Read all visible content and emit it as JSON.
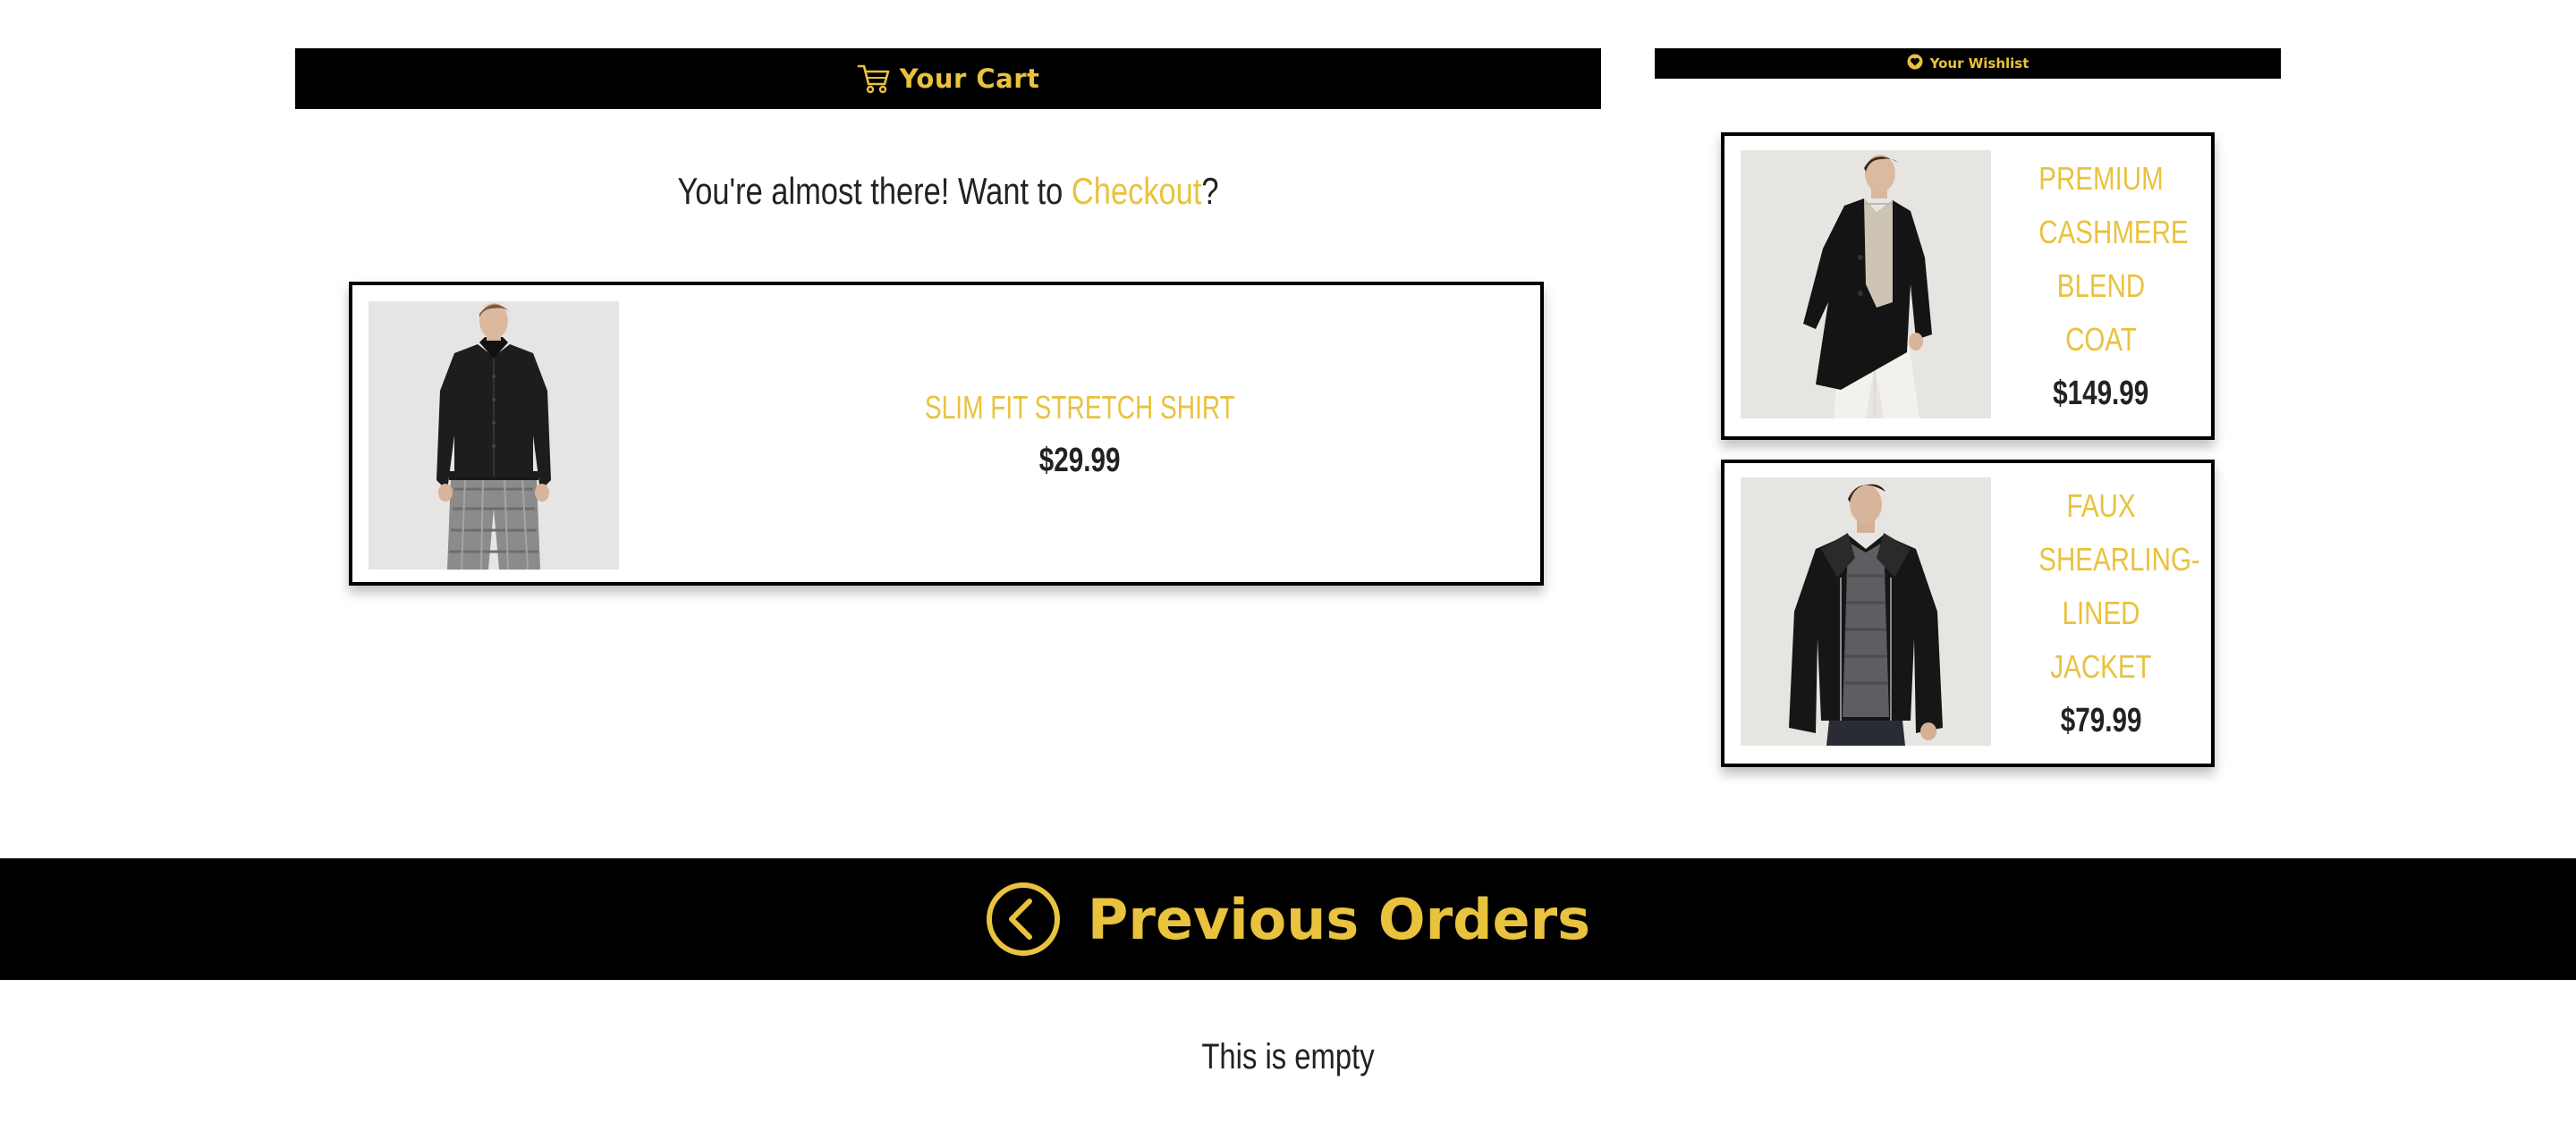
{
  "cart": {
    "title": "Your Cart",
    "icon": "cart-icon",
    "prompt_before": "You're almost there! Want to ",
    "prompt_link": "Checkout",
    "prompt_after": "?",
    "items": [
      {
        "name": "SLIM FIT STRETCH SHIRT",
        "price": "$29.99"
      }
    ]
  },
  "wishlist": {
    "title": "Your Wishlist",
    "icon": "heart-icon",
    "items": [
      {
        "name": "PREMIUM CASHMERE BLEND COAT",
        "price": "$149.99"
      },
      {
        "name": "FAUX SHEARLING-LINED JACKET",
        "price": "$79.99"
      }
    ]
  },
  "previous_orders": {
    "title": "Previous Orders",
    "icon": "chevron-left-circle-icon",
    "empty_text": "This is empty"
  },
  "colors": {
    "accent": "#e9c23e",
    "bar": "#000000",
    "text": "#222222"
  }
}
